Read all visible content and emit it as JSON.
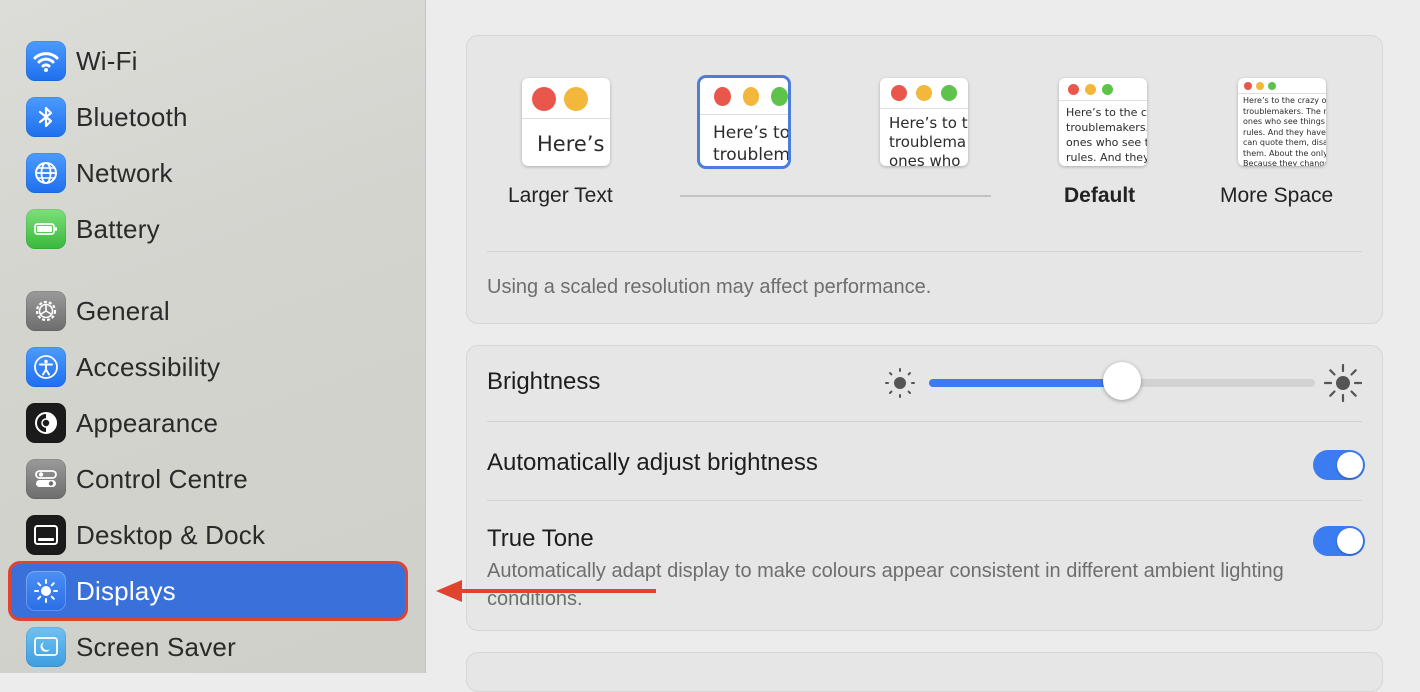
{
  "sidebar": {
    "items": [
      {
        "label": "Wi-Fi",
        "icon": "wifi-icon"
      },
      {
        "label": "Bluetooth",
        "icon": "bluetooth-icon"
      },
      {
        "label": "Network",
        "icon": "globe-icon"
      },
      {
        "label": "Battery",
        "icon": "battery-icon"
      },
      {
        "label": "General",
        "icon": "gear-icon"
      },
      {
        "label": "Accessibility",
        "icon": "accessibility-icon"
      },
      {
        "label": "Appearance",
        "icon": "appearance-icon"
      },
      {
        "label": "Control Centre",
        "icon": "control-centre-icon"
      },
      {
        "label": "Desktop & Dock",
        "icon": "desktop-dock-icon"
      },
      {
        "label": "Displays",
        "icon": "sun-icon",
        "selected": true
      },
      {
        "label": "Screen Saver",
        "icon": "screen-saver-icon"
      }
    ]
  },
  "resolution": {
    "options": [
      {
        "label": "Larger Text",
        "preview": "Here’s"
      },
      {
        "label": "",
        "preview": "Here’s to\ntroublem",
        "selected": true
      },
      {
        "label": "",
        "preview": "Here’s to t\ntroublema\nones who"
      },
      {
        "label": "Default",
        "preview": "Here’s to the cr\ntroublemakers.\nones who see t\nrules. And they"
      },
      {
        "label": "More Space",
        "preview": "Here’s to the crazy one\ntroublemakers. The rou\nones who see things dif\nrules. And they have no\ncan quote them, disagre\nthem. About the only th\nBecause they change t"
      }
    ],
    "note": "Using a scaled resolution may affect performance."
  },
  "brightness": {
    "label": "Brightness",
    "value": 0.5
  },
  "auto_brightness": {
    "label": "Automatically adjust brightness",
    "enabled": true
  },
  "true_tone": {
    "label": "True Tone",
    "description": "Automatically adapt display to make colours appear consistent in different ambient lighting conditions.",
    "enabled": true
  },
  "colors": {
    "accent": "#3b7df0",
    "sidebar_selected": "#3a70d9",
    "annotation": "#e0442f"
  }
}
